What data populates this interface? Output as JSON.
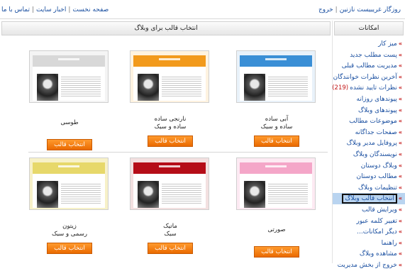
{
  "topbar": {
    "left_links": [
      "تماس با ما",
      "اخبار سایت",
      "صفحه نخست"
    ],
    "right_links": [
      "روزگار غریبیست نازنین",
      "خروج"
    ]
  },
  "sidebar": {
    "title": "امکانات",
    "items": [
      {
        "label": "میز کار"
      },
      {
        "label": "پست مطلب جدید"
      },
      {
        "label": "مدیریت مطالب قبلی"
      },
      {
        "label": "آخرین نظرات خوانندگان"
      },
      {
        "label": "نظرات تایید نشده",
        "count": "(219)"
      },
      {
        "label": "پیوندهای روزانه"
      },
      {
        "label": "پیوندهای وبلاگ"
      },
      {
        "label": "موضوعات مطالب"
      },
      {
        "label": "صفحات جداگانه"
      },
      {
        "label": "پروفایل مدیر وبلاگ"
      },
      {
        "label": "نویسندگان وبلاگ"
      },
      {
        "label": "وبلاگ دوستان"
      },
      {
        "label": "مطالب دوستان"
      },
      {
        "label": "تنظیمات وبلاگ"
      },
      {
        "label": "انتخاب قالب وبلاگ",
        "active": true
      },
      {
        "label": "ویرایش قالب"
      },
      {
        "label": "تغییر کلمه عبور"
      },
      {
        "label": "دیگر امکانات..."
      },
      {
        "label": "راهنما"
      },
      {
        "label": "مشاهده وبلاگ"
      },
      {
        "label": "خروج از بخش مدیریت"
      }
    ]
  },
  "main": {
    "title": "انتخاب قالب برای وبلاگ",
    "select_label": "انتخاب قالب",
    "templates": [
      {
        "name": "آبی ساده",
        "style": "ساده و سبک",
        "band_color": "#3a8fd6",
        "bg_color": "#e9f2fa"
      },
      {
        "name": "نارنجی ساده",
        "style": "ساده و سبک",
        "band_color": "#f29a1c",
        "bg_color": "#fff3e0"
      },
      {
        "name": "طوسی",
        "style": "",
        "band_color": "#d8d8d8",
        "bg_color": "#f4f4f4"
      },
      {
        "name": "صورتی",
        "style": "",
        "band_color": "#f4a6c8",
        "bg_color": "#fdeaf3"
      },
      {
        "name": "ماتیک",
        "style": "سبک",
        "band_color": "#b50d18",
        "bg_color": "#f3e0e0"
      },
      {
        "name": "زیتون",
        "style": "رسمی و سبک",
        "band_color": "#e7d86a",
        "bg_color": "#f7f1c8"
      }
    ]
  }
}
